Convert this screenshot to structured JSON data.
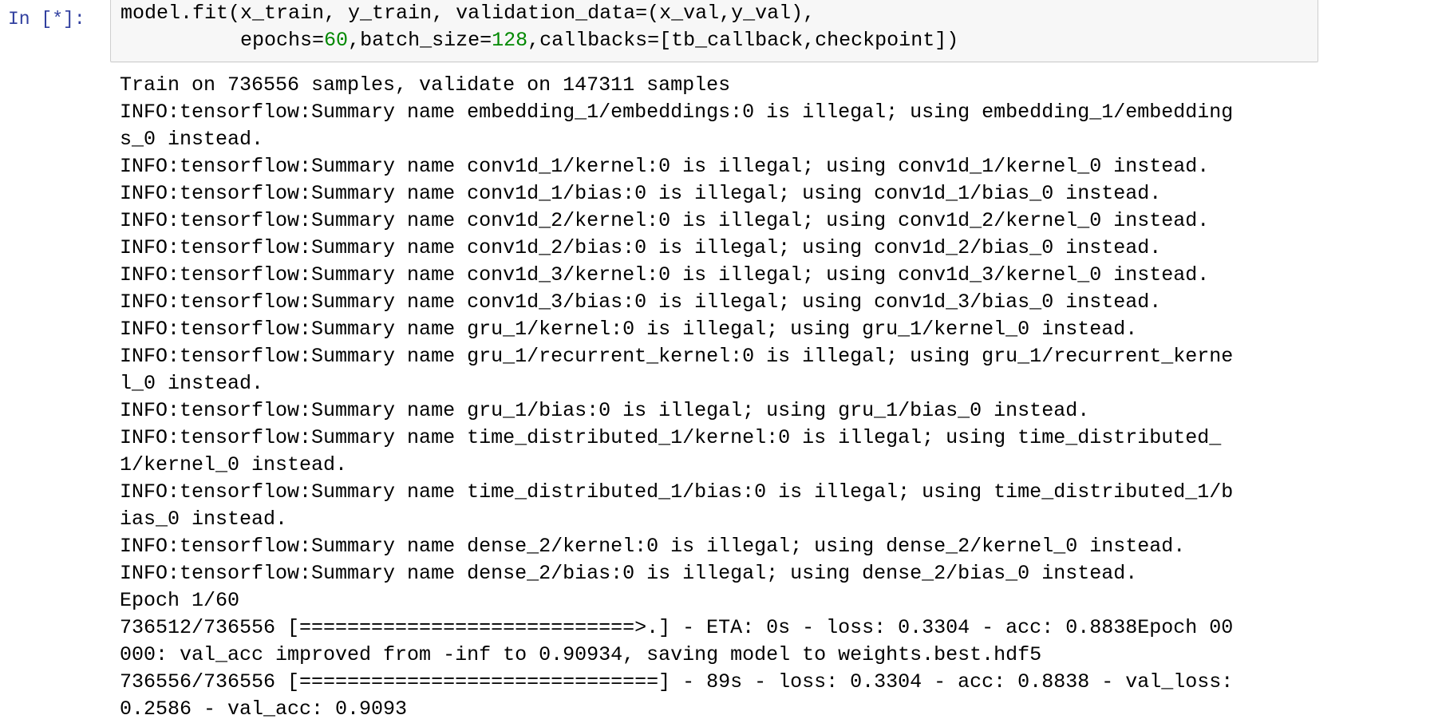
{
  "prompt": "In [*]:",
  "code": {
    "line1": "model.fit(x_train, y_train, validation_data=(x_val,y_val),",
    "line2_pre": "          epochs=",
    "epochs": "60",
    "line2_mid": ",batch_size=",
    "batch_size": "128",
    "line2_post": ",callbacks=[tb_callback,checkpoint])"
  },
  "output_lines": [
    "Train on 736556 samples, validate on 147311 samples",
    "INFO:tensorflow:Summary name embedding_1/embeddings:0 is illegal; using embedding_1/embedding",
    "s_0 instead.",
    "INFO:tensorflow:Summary name conv1d_1/kernel:0 is illegal; using conv1d_1/kernel_0 instead.",
    "INFO:tensorflow:Summary name conv1d_1/bias:0 is illegal; using conv1d_1/bias_0 instead.",
    "INFO:tensorflow:Summary name conv1d_2/kernel:0 is illegal; using conv1d_2/kernel_0 instead.",
    "INFO:tensorflow:Summary name conv1d_2/bias:0 is illegal; using conv1d_2/bias_0 instead.",
    "INFO:tensorflow:Summary name conv1d_3/kernel:0 is illegal; using conv1d_3/kernel_0 instead.",
    "INFO:tensorflow:Summary name conv1d_3/bias:0 is illegal; using conv1d_3/bias_0 instead.",
    "INFO:tensorflow:Summary name gru_1/kernel:0 is illegal; using gru_1/kernel_0 instead.",
    "INFO:tensorflow:Summary name gru_1/recurrent_kernel:0 is illegal; using gru_1/recurrent_kerne",
    "l_0 instead.",
    "INFO:tensorflow:Summary name gru_1/bias:0 is illegal; using gru_1/bias_0 instead.",
    "INFO:tensorflow:Summary name time_distributed_1/kernel:0 is illegal; using time_distributed_",
    "1/kernel_0 instead.",
    "INFO:tensorflow:Summary name time_distributed_1/bias:0 is illegal; using time_distributed_1/b",
    "ias_0 instead.",
    "INFO:tensorflow:Summary name dense_2/kernel:0 is illegal; using dense_2/kernel_0 instead.",
    "INFO:tensorflow:Summary name dense_2/bias:0 is illegal; using dense_2/bias_0 instead.",
    "Epoch 1/60",
    "736512/736556 [============================>.] - ETA: 0s - loss: 0.3304 - acc: 0.8838Epoch 00",
    "000: val_acc improved from -inf to 0.90934, saving model to weights.best.hdf5",
    "736556/736556 [==============================] - 89s - loss: 0.3304 - acc: 0.8838 - val_loss:",
    "0.2586 - val_acc: 0.9093"
  ],
  "colors": {
    "prompt": "#303f9f",
    "number_literal": "#008800",
    "input_background": "#f7f7f7",
    "input_border": "#cfcfcf"
  }
}
